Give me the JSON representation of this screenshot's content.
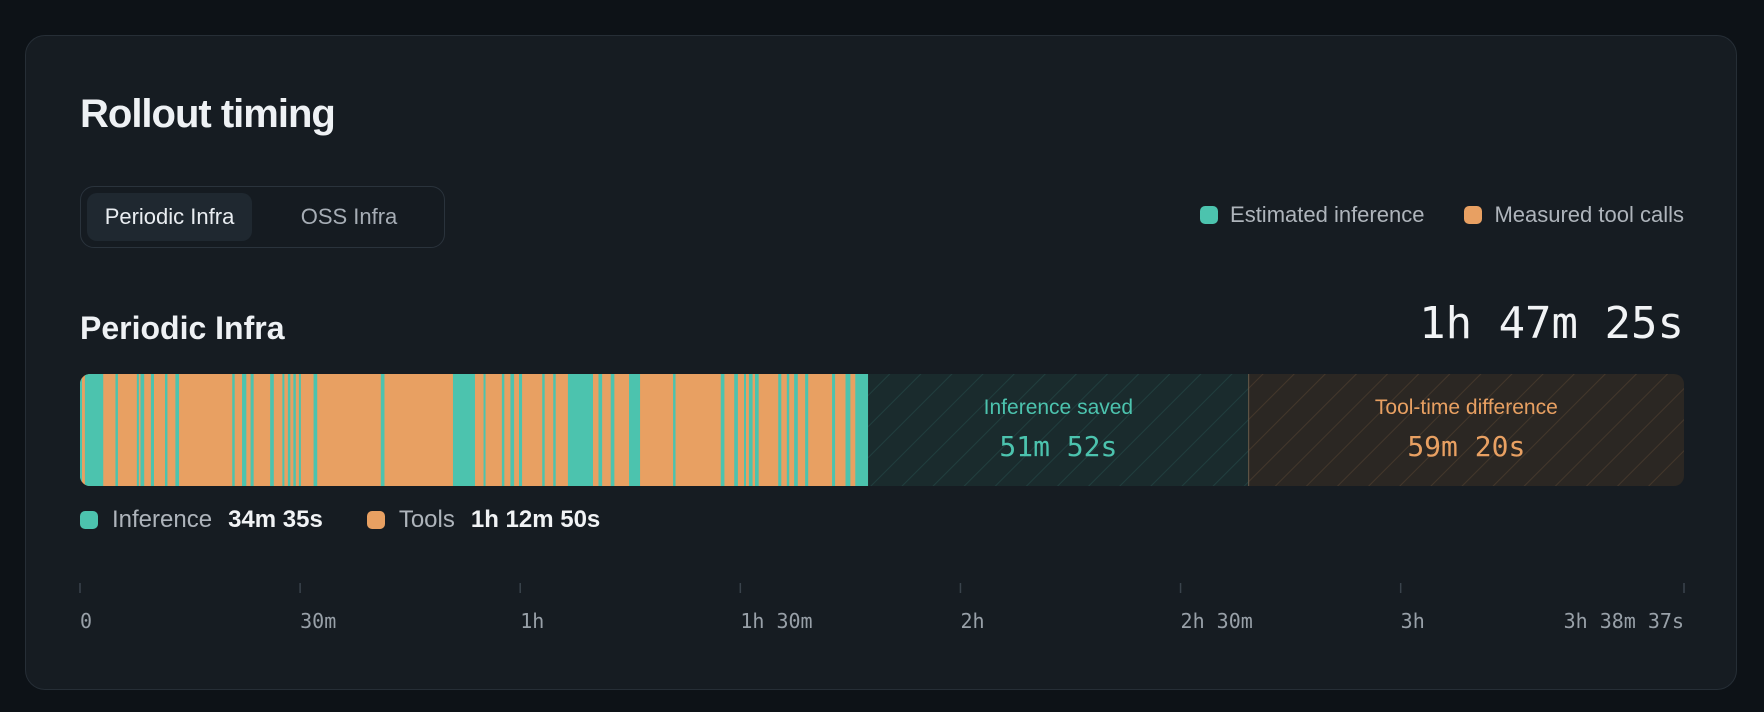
{
  "title": "Rollout timing",
  "tabs": [
    {
      "label": "Periodic Infra",
      "active": true
    },
    {
      "label": "OSS Infra",
      "active": false
    }
  ],
  "legend": {
    "inference_label": "Estimated inference",
    "tools_label": "Measured tool calls"
  },
  "colors": {
    "inference": "#4cc3ae",
    "tools": "#e8a062",
    "saved_fill": "#1a2b2d",
    "diff_fill": "#2b2723"
  },
  "section": {
    "title": "Periodic Infra",
    "total": "1h 47m 25s"
  },
  "panels": {
    "saved": {
      "label": "Inference saved",
      "value": "51m 52s"
    },
    "diff": {
      "label": "Tool-time difference",
      "value": "59m 20s"
    }
  },
  "summary": {
    "inference_label": "Inference",
    "inference_value": "34m 35s",
    "tools_label": "Tools",
    "tools_value": "1h 12m 50s"
  },
  "chart_data": {
    "type": "bar",
    "orientation": "horizontal-timeline",
    "axis_max_seconds": 13117,
    "x_ticks": [
      {
        "label": "0",
        "seconds": 0
      },
      {
        "label": "30m",
        "seconds": 1800
      },
      {
        "label": "1h",
        "seconds": 3600
      },
      {
        "label": "1h 30m",
        "seconds": 5400
      },
      {
        "label": "2h",
        "seconds": 7200
      },
      {
        "label": "2h 30m",
        "seconds": 9000
      },
      {
        "label": "3h",
        "seconds": 10800
      },
      {
        "label": "3h 38m 37s",
        "seconds": 13117
      }
    ],
    "timeline_end_seconds": 6445,
    "saved_end_seconds": 9557,
    "diff_end_seconds": 13117,
    "inference_spans": [
      [
        0,
        15
      ],
      [
        40,
        190
      ],
      [
        290,
        310
      ],
      [
        465,
        480
      ],
      [
        495,
        525
      ],
      [
        580,
        605
      ],
      [
        695,
        715
      ],
      [
        780,
        810
      ],
      [
        1245,
        1265
      ],
      [
        1325,
        1360
      ],
      [
        1395,
        1420
      ],
      [
        1555,
        1585
      ],
      [
        1655,
        1670
      ],
      [
        1700,
        1720
      ],
      [
        1745,
        1765
      ],
      [
        1790,
        1805
      ],
      [
        1910,
        1940
      ],
      [
        2460,
        2490
      ],
      [
        3050,
        3230
      ],
      [
        3300,
        3315
      ],
      [
        3450,
        3470
      ],
      [
        3520,
        3550
      ],
      [
        3590,
        3615
      ],
      [
        3780,
        3800
      ],
      [
        3870,
        3890
      ],
      [
        3990,
        4195
      ],
      [
        4240,
        4270
      ],
      [
        4340,
        4370
      ],
      [
        4490,
        4580
      ],
      [
        4850,
        4870
      ],
      [
        5240,
        5270
      ],
      [
        5350,
        5380
      ],
      [
        5430,
        5445
      ],
      [
        5470,
        5500
      ],
      [
        5520,
        5550
      ],
      [
        5710,
        5735
      ],
      [
        5780,
        5800
      ],
      [
        5840,
        5870
      ],
      [
        5930,
        5955
      ],
      [
        6150,
        6175
      ],
      [
        6260,
        6300
      ],
      [
        6340,
        6445
      ]
    ]
  }
}
